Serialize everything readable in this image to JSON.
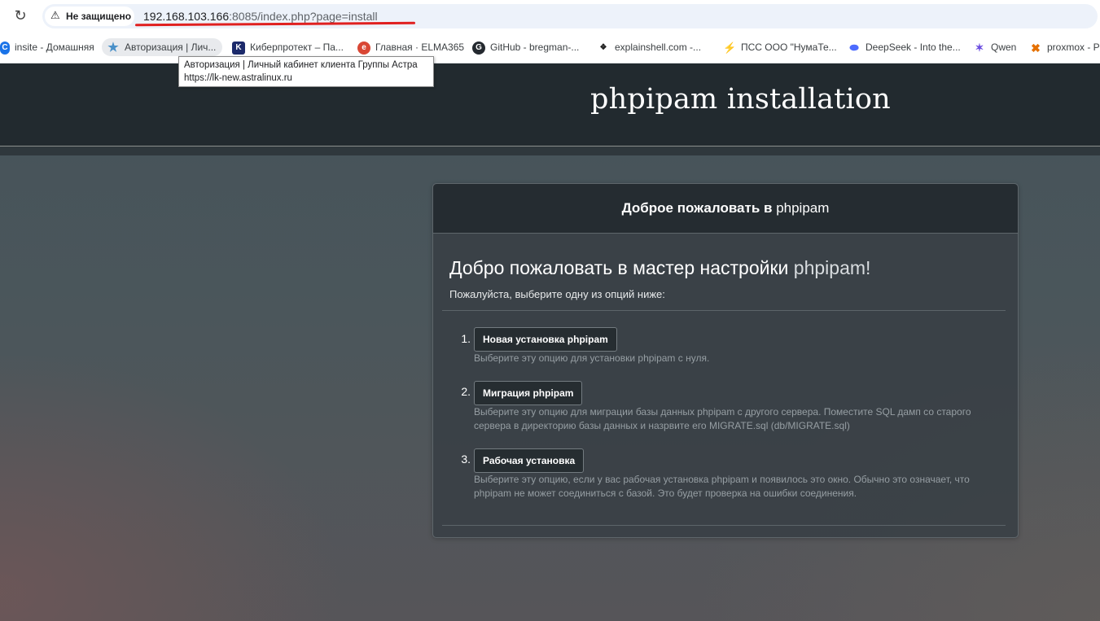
{
  "browser": {
    "security_label": "Не защищено",
    "url": {
      "host": "192.168.103.166",
      "rest": ":8085/index.php?page=install"
    },
    "bookmarks": [
      {
        "label": "insite - Домашняя",
        "icon": "insite-icon",
        "color": "#1a73e8"
      },
      {
        "label": "Авторизация | Лич...",
        "icon": "star-icon",
        "color": "#4a90c8"
      },
      {
        "label": "Киберпротект – Па...",
        "icon": "cyberprotect-icon",
        "color": "#1c2a6b"
      },
      {
        "label": "Главная · ELMA365",
        "icon": "elma-icon",
        "color": "#d94735"
      },
      {
        "label": "GitHub - bregman-...",
        "icon": "github-icon",
        "color": "#24292f"
      },
      {
        "label": "explainshell.com -...",
        "icon": "explainshell-icon",
        "color": "#222222"
      },
      {
        "label": "ПСС ООО \"НумаТе...",
        "icon": "lightning-icon",
        "color": "#1a73e8"
      },
      {
        "label": "DeepSeek - Into the...",
        "icon": "deepseek-icon",
        "color": "#4d6bfe"
      },
      {
        "label": "Qwen",
        "icon": "qwen-icon",
        "color": "#6a4ce0"
      },
      {
        "label": "proxmox - P",
        "icon": "proxmox-icon",
        "color": "#e57000"
      }
    ],
    "tooltip": {
      "title": "Авторизация | Личный кабинет клиента Группы Астра",
      "url": "https://lk-new.astralinux.ru"
    }
  },
  "header": {
    "title": "phpipam installation"
  },
  "panel": {
    "heading_strong": "Доброе пожаловать в",
    "heading_app": " phpipam",
    "wizard_title": "Добро пожаловать в мастер настройки",
    "wizard_title_app": " phpipam!",
    "subtitle": "Пожалуйста, выберите одну из опций ниже:",
    "options": [
      {
        "number": "1.",
        "button": "Новая установка phpipam",
        "description": "Выберите эту опцию для установки phpipam с нуля."
      },
      {
        "number": "2.",
        "button": "Миграция phpipam",
        "description": "Выберите эту опцию для миграции базы данных phpipam с другого сервера. Поместите SQL дамп со старого сервера в директорию базы данных и назрвите его MIGRATE.sql (db/MIGRATE.sql)"
      },
      {
        "number": "3.",
        "button": "Рабочая установка",
        "description": "Выберите эту опцию, если у вас рабочая установка phpipam и появилось это окно. Обычно это означает, что phpipam не может соединиться с базой. Это будет проверка на ошибки соединения."
      }
    ]
  },
  "colors": {
    "header_bg": "#222a2f",
    "panel_bg": "#383f44",
    "url_underline": "#e02020"
  }
}
